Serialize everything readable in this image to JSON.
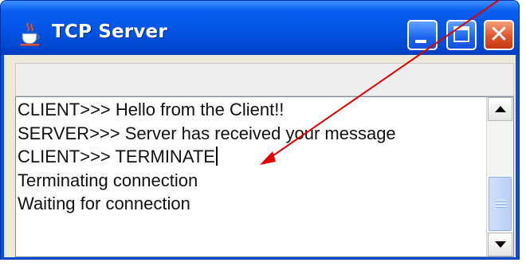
{
  "window": {
    "title": "TCP Server",
    "buttons": {
      "minimize": "minimize",
      "maximize": "maximize",
      "close": "close"
    }
  },
  "input_field": {
    "value": ""
  },
  "display": {
    "lines": [
      "CLIENT>>> Hello from the Client!!",
      "SERVER>>> Server has received your message",
      "CLIENT>>> TERMINATE",
      "Terminating connection",
      "Waiting for connection"
    ]
  },
  "icons": {
    "app": "java-coffee-cup-icon",
    "scroll_up": "scroll-up-arrow-icon",
    "scroll_down": "scroll-down-arrow-icon"
  },
  "colors": {
    "titlebar": "#0255e4",
    "close_button": "#e1522a",
    "annotation_arrow": "#e00000"
  }
}
